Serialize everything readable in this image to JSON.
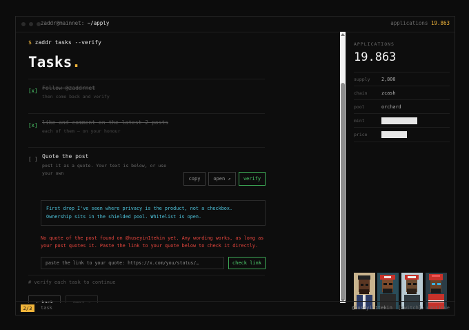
{
  "titlebar": {
    "user_host": "zaddr@mainnet:",
    "path": "~/apply",
    "apps_label": "applications",
    "apps_value": "19.863"
  },
  "main": {
    "prompt": "$",
    "command": "zaddr tasks --verify",
    "heading": "Tasks",
    "heading_dot": ".",
    "tasks": [
      {
        "check": "[x]",
        "title": "Follow @zaddrnet",
        "subtitle": "then come back and verify"
      },
      {
        "check": "[x]",
        "title": "like and comment on the latest 2 posts",
        "subtitle": "each of them — on your honour"
      },
      {
        "check": "[ ]",
        "title": "Quote the post",
        "subtitle": "post it as a quote. Your text is below, or use your own"
      }
    ],
    "buttons": {
      "copy": "copy",
      "open": "open ↗",
      "verify": "verify"
    },
    "quote_text": "First drop I've seen where privacy is the product, not a checkbox. Ownership sits in the shielded pool. Whitelist is open.",
    "error_text": "No quote of the post found on @huseyin1tekin yet. Any wording works, as long as your post quotes it. Paste the link to your quote below to check it directly.",
    "link_placeholder": "paste the link to your quote: https://x.com/you/status/…",
    "check_link": "check link",
    "hint": "# verify each task to continue",
    "back": "← back",
    "next": "next →"
  },
  "sidebar": {
    "label": "APPLICATIONS",
    "value": "19.863",
    "rows": [
      {
        "key": "supply",
        "value": "2,800"
      },
      {
        "key": "chain",
        "value": "zcash"
      },
      {
        "key": "pool",
        "value": "orchard"
      },
      {
        "key": "mint",
        "value": ""
      },
      {
        "key": "price",
        "value": ""
      }
    ],
    "redaction_fill": {
      "mint": 0.82,
      "price": 0.58
    }
  },
  "footer": {
    "step": "2/3",
    "label": "task",
    "user": "@huseyin1tekin",
    "switch": "[switch]",
    "continue": "↵ continue"
  },
  "colors": {
    "accent": "#f0b43a",
    "success": "#4fd06e",
    "error": "#e8463e",
    "quote": "#4fc6de"
  }
}
